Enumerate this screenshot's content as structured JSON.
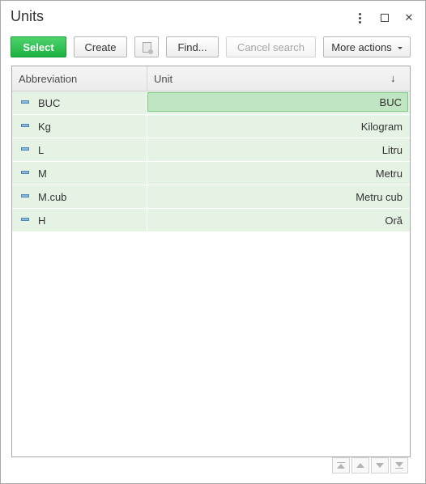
{
  "window": {
    "title": "Units",
    "controls": {
      "more_icon": "more-vertical-icon",
      "maximize_icon": "maximize-icon",
      "close_icon": "close-icon",
      "close_glyph": "✕"
    }
  },
  "toolbar": {
    "select_label": "Select",
    "create_label": "Create",
    "copy_icon": "copy-icon",
    "find_label": "Find...",
    "cancel_search_label": "Cancel search",
    "more_actions_label": "More actions"
  },
  "table": {
    "columns": [
      {
        "key": "abbreviation",
        "label": "Abbreviation"
      },
      {
        "key": "unit",
        "label": "Unit"
      }
    ],
    "sort_indicator": "↓",
    "rows": [
      {
        "abbreviation": "BUC",
        "unit": "BUC",
        "current": true
      },
      {
        "abbreviation": "Kg",
        "unit": "Kilogram"
      },
      {
        "abbreviation": "L",
        "unit": "Litru"
      },
      {
        "abbreviation": "M",
        "unit": "Metru"
      },
      {
        "abbreviation": "M.cub",
        "unit": "Metru cub"
      },
      {
        "abbreviation": "H",
        "unit": "Oră"
      }
    ]
  },
  "navigation": {
    "first_icon": "go-first-icon",
    "prev_icon": "go-previous-icon",
    "next_icon": "go-next-icon",
    "last_icon": "go-last-icon"
  },
  "colors": {
    "select_button": "#1bb140",
    "row_background": "#e5f3e5",
    "current_cell": "#bfe5c2"
  }
}
